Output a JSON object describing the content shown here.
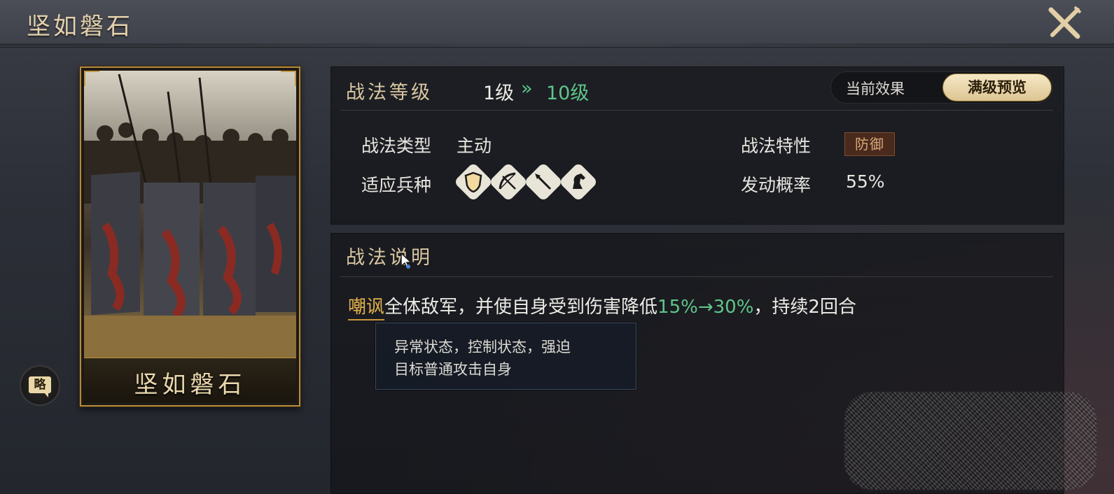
{
  "header": {
    "title": "坚如磐石"
  },
  "card": {
    "name": "坚如磐石",
    "badge": "略"
  },
  "level": {
    "section_title": "战法等级",
    "from": "1级",
    "arrow": "»",
    "to": "10级",
    "toggle": {
      "current": "当前效果",
      "max": "满级预览",
      "selected": "满级预览"
    }
  },
  "attributes": {
    "type_label": "战法类型",
    "type_value": "主动",
    "troops_label": "适应兵种",
    "troops": [
      "shield-icon",
      "bow-icon",
      "spear-icon",
      "horse-icon"
    ],
    "trait_label": "战法特性",
    "trait_value": "防御",
    "rate_label": "发动概率",
    "rate_value": "55%"
  },
  "description": {
    "section_title": "战法说明",
    "keyword": "嘲讽",
    "text_before": "全体敌军，并使自身受到伤害降低",
    "percent": "15%→30%",
    "text_after": "，持续2回合"
  },
  "tooltip": {
    "line1": "异常状态，控制状态，强迫",
    "line2": "目标普通攻击自身"
  },
  "colors": {
    "accent_gold": "#e4d2ad",
    "green": "#5fc58a",
    "keyword": "#e5b24a"
  }
}
